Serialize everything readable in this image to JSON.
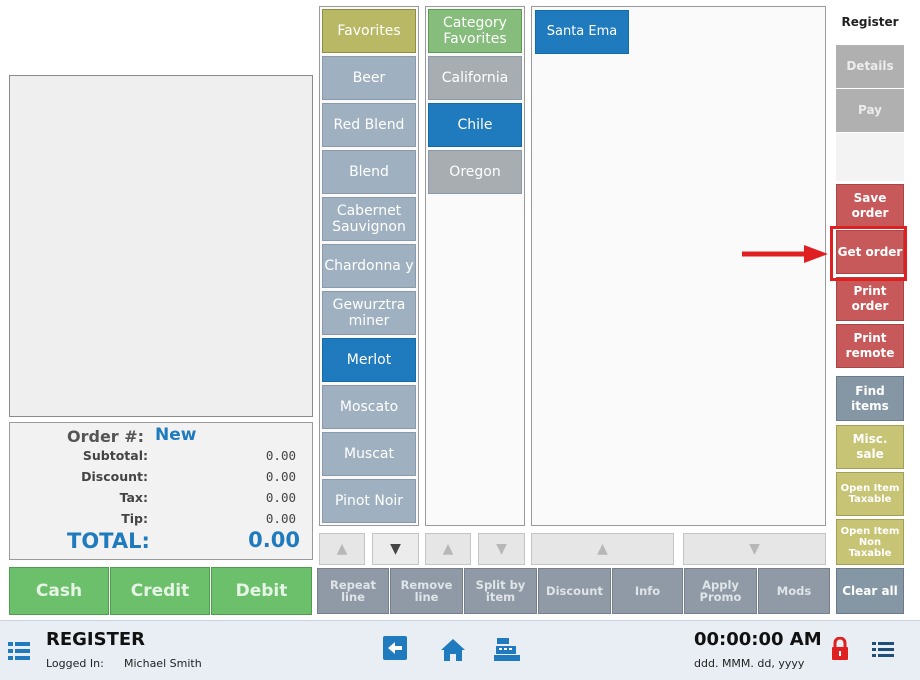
{
  "order": {
    "number_label": "Order #:",
    "number_value": "New",
    "rows": [
      {
        "label": "Subtotal:",
        "value": "0.00"
      },
      {
        "label": "Discount:",
        "value": "0.00"
      },
      {
        "label": "Tax:",
        "value": "0.00"
      },
      {
        "label": "Tip:",
        "value": "0.00"
      }
    ],
    "total_label": "TOTAL:",
    "total_value": "0.00"
  },
  "payment": [
    "Cash",
    "Credit",
    "Debit"
  ],
  "categories": [
    "Favorites",
    "Beer",
    "Red Blend",
    "Blend",
    "Cabernet Sauvignon",
    "Chardonna y",
    "Gewurztra miner",
    "Merlot",
    "Moscato",
    "Muscat",
    "Pinot Noir"
  ],
  "subcategories": [
    "Category Favorites",
    "California",
    "Chile",
    "Oregon"
  ],
  "items": [
    "Santa Ema"
  ],
  "actions": [
    "Repeat line",
    "Remove line",
    "Split by item",
    "Discount",
    "Info",
    "Apply Promo",
    "Mods"
  ],
  "rail": {
    "register": "Register",
    "details": "Details",
    "pay": "Pay",
    "save_order": "Save order",
    "get_order": "Get order",
    "print_order": "Print order",
    "print_remote": "Print remote",
    "find_items": "Find items",
    "misc_sale": "Misc. sale",
    "open_taxable": "Open Item Taxable",
    "open_non_taxable": "Open Item Non Taxable",
    "clear_all": "Clear all"
  },
  "footer": {
    "title": "REGISTER",
    "logged_label": "Logged In:",
    "user": "Michael Smith",
    "time": "00:00:00 AM",
    "date_format": "ddd. MMM. dd, yyyy"
  },
  "colors": {
    "accent_blue": "#1f7bbd",
    "pay_green": "#6cc06c",
    "rail_red": "#c8595b",
    "highlight_red": "#e02020"
  }
}
